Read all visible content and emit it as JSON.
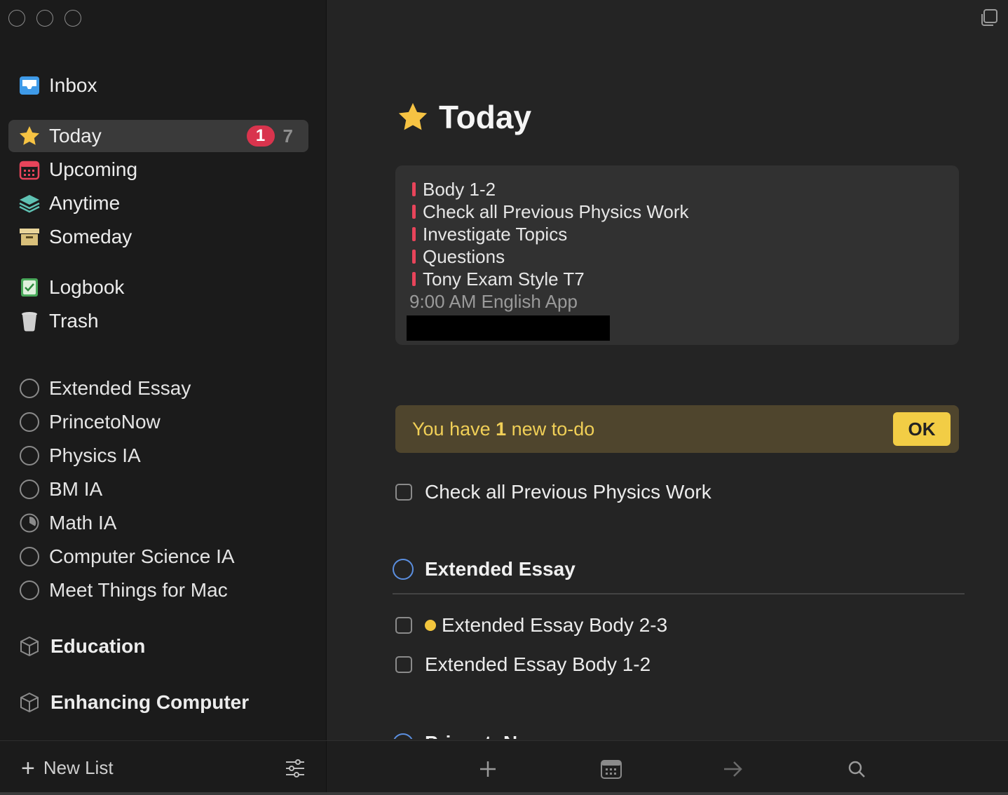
{
  "sidebar": {
    "inbox": {
      "label": "Inbox"
    },
    "nav": [
      {
        "label": "Today",
        "badge": "1",
        "count": "7"
      },
      {
        "label": "Upcoming"
      },
      {
        "label": "Anytime"
      },
      {
        "label": "Someday"
      }
    ],
    "logbook": {
      "label": "Logbook"
    },
    "trash": {
      "label": "Trash"
    },
    "projects": [
      {
        "label": "Extended Essay"
      },
      {
        "label": "PrincetoNow"
      },
      {
        "label": "Physics IA"
      },
      {
        "label": "BM IA"
      },
      {
        "label": "Math IA",
        "progress": 0.35
      },
      {
        "label": "Computer Science IA"
      },
      {
        "label": "Meet Things for Mac"
      }
    ],
    "areas": [
      {
        "label": "Education"
      },
      {
        "label": "Enhancing Computer"
      }
    ],
    "footer": {
      "new_list_label": "New List"
    }
  },
  "main": {
    "title": "Today",
    "calendar_events": [
      {
        "label": "Body 1-2"
      },
      {
        "label": "Check all Previous Physics Work"
      },
      {
        "label": "Investigate Topics"
      },
      {
        "label": "Questions"
      },
      {
        "label": "Tony Exam Style T7"
      },
      {
        "label": "9:00 AM English App"
      }
    ],
    "notice": {
      "prefix": "You have ",
      "count": "1",
      "suffix": " new to-do",
      "button": "OK"
    },
    "todos": [
      {
        "label": "Check all Previous Physics Work"
      }
    ],
    "section": {
      "title": "Extended Essay",
      "items": [
        {
          "label": "Extended Essay Body 2-3",
          "flag": "yellow-dot"
        },
        {
          "label": "Extended Essay Body 1-2"
        }
      ]
    },
    "next_section_partial": "PrincetoNow"
  },
  "colors": {
    "accent_red": "#d9344d",
    "accent_yellow": "#f2cd45",
    "accent_blue": "#5b8fe0"
  }
}
